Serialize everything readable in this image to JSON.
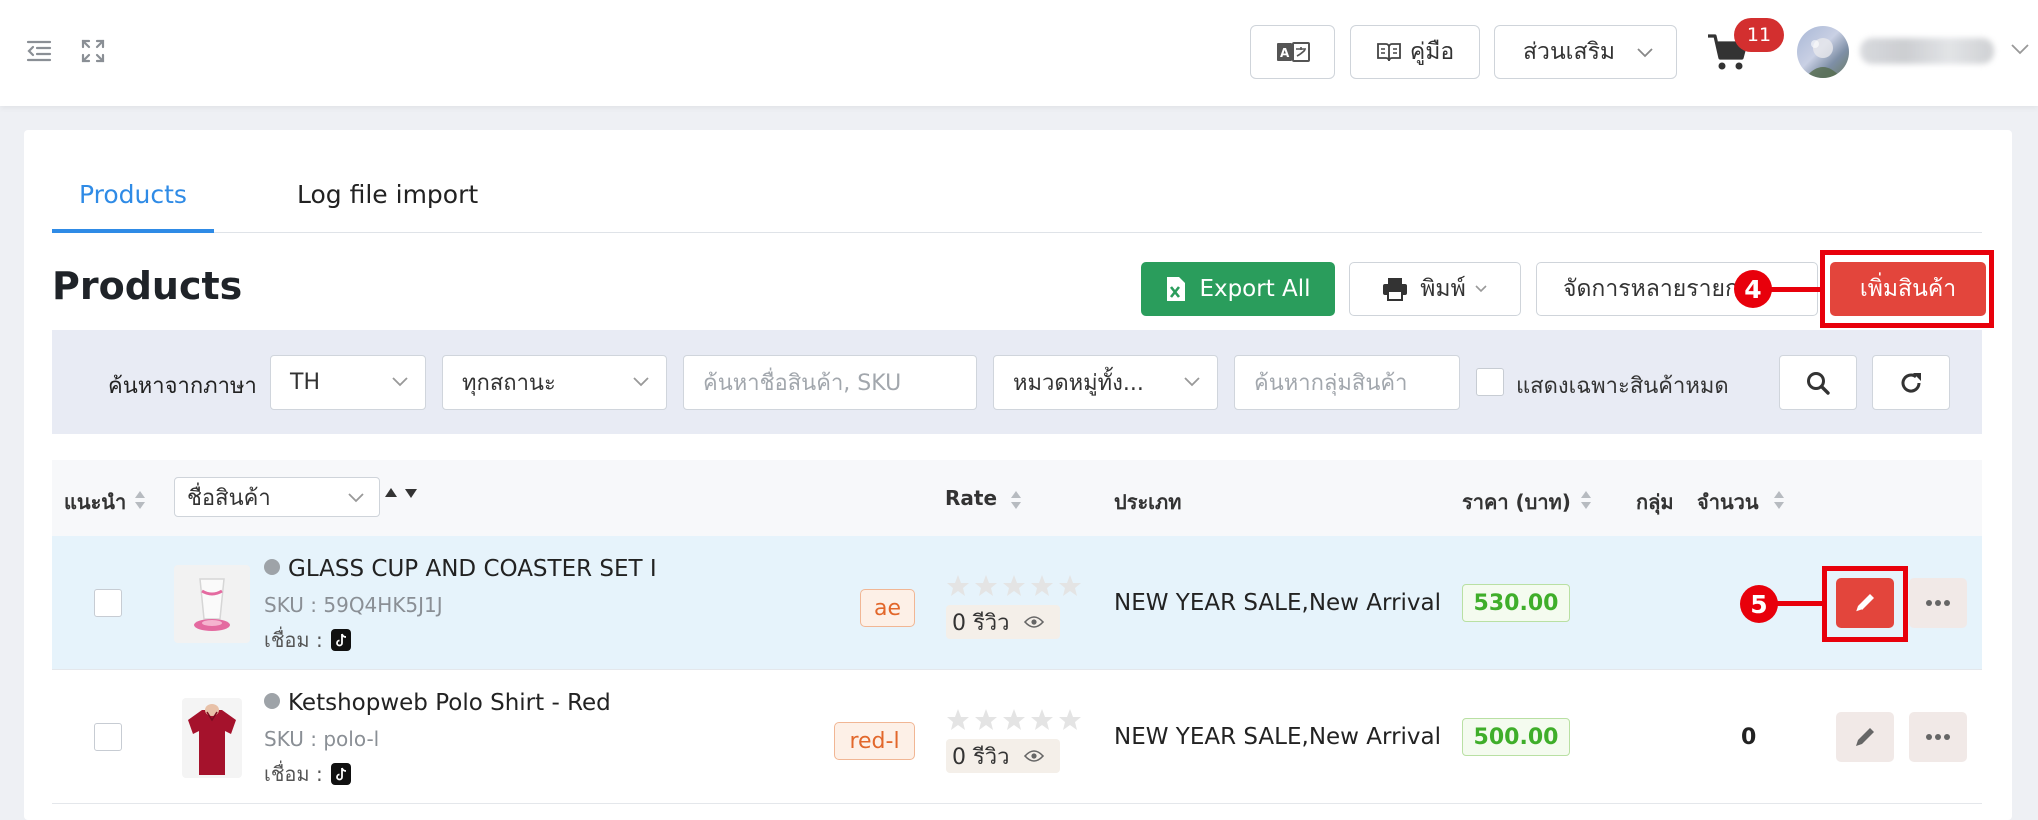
{
  "header": {
    "translate_icon": "translate-icon",
    "manual_label": "คู่มือ",
    "addons_label": "ส่วนเสริม",
    "cart_count": "11"
  },
  "tabs": [
    {
      "label": "Products",
      "active": true
    },
    {
      "label": "Log file import",
      "active": false
    }
  ],
  "page": {
    "title": "Products",
    "export_label": "Export All",
    "print_label": "พิมพ์",
    "bulk_label": "จัดการหลายรายการ",
    "add_label": "เพิ่มสินค้า",
    "step_add": "4",
    "step_edit": "5"
  },
  "filters": {
    "language_label": "ค้นหาจากภาษา",
    "language_value": "TH",
    "status_value": "ทุกสถานะ",
    "search_placeholder": "ค้นหาชื่อสินค้า, SKU",
    "category_value": "หมวดหมู่ทั้ง...",
    "group_placeholder": "ค้นหากลุ่มสินค้า",
    "out_of_stock_label": "แสดงเฉพาะสินค้าหมด"
  },
  "table": {
    "col_recommend": "แนะนำ",
    "name_select": "ชื่อสินค้า",
    "col_rate": "Rate",
    "col_type": "ประเภท",
    "col_price": "ราคา (บาท)",
    "col_group": "กลุ่ม",
    "col_qty": "จำนวน",
    "rows": [
      {
        "name": "GLASS CUP AND COASTER SET I",
        "sku": "SKU : 59Q4HK5J1J",
        "connect_label": "เชื่อม :",
        "tag": "ae",
        "rating": 0,
        "reviews": "0 รีวิว",
        "type": "NEW YEAR SALE,New Arrival",
        "price": "530.00",
        "qty": ""
      },
      {
        "name": "Ketshopweb Polo Shirt - Red",
        "sku": "SKU : polo-l",
        "connect_label": "เชื่อม :",
        "tag": "red-l",
        "rating": 0,
        "reviews": "0 รีวิว",
        "type": "NEW YEAR SALE,New Arrival",
        "price": "500.00",
        "qty": "0"
      }
    ]
  },
  "colors": {
    "accent_blue": "#2f8be6",
    "export_green": "#2a9d5c",
    "add_red": "#e3453c",
    "highlight_red": "#e8000b",
    "price_green": "#3fae2a"
  }
}
